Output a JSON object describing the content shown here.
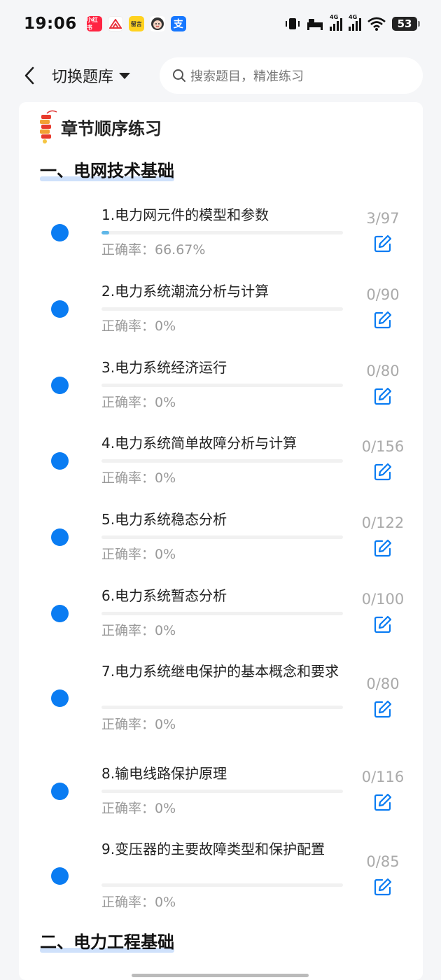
{
  "status_bar": {
    "time": "19:06",
    "app_badges": [
      "小红书",
      "留言"
    ],
    "network": "4G",
    "battery": "53"
  },
  "nav": {
    "title": "切换题库",
    "search_placeholder": "搜索题目，精准练习"
  },
  "card": {
    "title": "章节顺序练习",
    "sections": [
      {
        "heading": "一、电网技术基础",
        "chapters": [
          {
            "title": "1.电力网元件的模型和参数",
            "accuracy": "正确率：66.67%",
            "count": "3/97",
            "progress": 0.031
          },
          {
            "title": "2.电力系统潮流分析与计算",
            "accuracy": "正确率：0%",
            "count": "0/90",
            "progress": 0
          },
          {
            "title": "3.电力系统经济运行",
            "accuracy": "正确率：0%",
            "count": "0/80",
            "progress": 0
          },
          {
            "title": "4.电力系统简单故障分析与计算",
            "accuracy": "正确率：0%",
            "count": "0/156",
            "progress": 0
          },
          {
            "title": "5.电力系统稳态分析",
            "accuracy": "正确率：0%",
            "count": "0/122",
            "progress": 0
          },
          {
            "title": "6.电力系统暂态分析",
            "accuracy": "正确率：0%",
            "count": "0/100",
            "progress": 0
          },
          {
            "title": "7.电力系统继电保护的基本概念和要求",
            "accuracy": "正确率：0%",
            "count": "0/80",
            "progress": 0
          },
          {
            "title": "8.输电线路保护原理",
            "accuracy": "正确率：0%",
            "count": "0/116",
            "progress": 0
          },
          {
            "title": "9.变压器的主要故障类型和保护配置",
            "accuracy": "正确率：0%",
            "count": "0/85",
            "progress": 0
          }
        ]
      },
      {
        "heading": "二、电力工程基础",
        "chapters": []
      }
    ]
  },
  "colors": {
    "accent": "#0a7cf2",
    "progress": "#5fb7e8",
    "heading_underline": "#cfe1fb"
  }
}
